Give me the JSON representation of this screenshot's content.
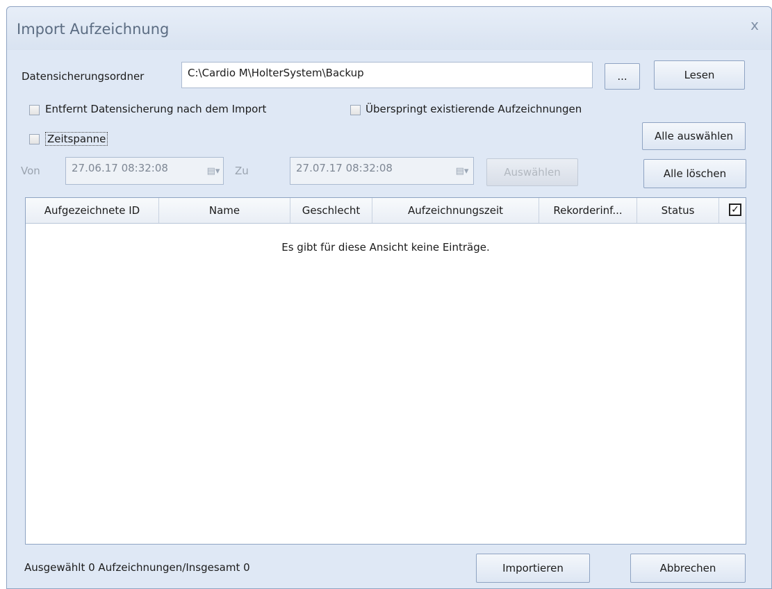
{
  "window": {
    "title": "Import Aufzeichnung",
    "close_glyph": "x"
  },
  "backup": {
    "label": "Datensicherungsordner",
    "path": "C:\\Cardio M\\HolterSystem\\Backup",
    "browse_label": "...",
    "read_label": "Lesen"
  },
  "options": {
    "remove_backup_label": "Entfernt Datensicherung nach dem Import",
    "skip_existing_label": "Überspringt existierende Aufzeichnungen",
    "timespan_label": "Zeitspanne"
  },
  "range": {
    "from_label": "Von",
    "from_value": "27.06.17  08:32:08",
    "to_label": "Zu",
    "to_value": "27.07.17  08:32:08",
    "select_label": "Auswählen"
  },
  "actions": {
    "select_all_label": "Alle auswählen",
    "clear_all_label": "Alle löschen",
    "import_label": "Importieren",
    "cancel_label": "Abbrechen"
  },
  "table": {
    "columns": [
      "Aufgezeichnete ID",
      "Name",
      "Geschlecht",
      "Aufzeichnungszeit",
      "Rekorderinf...",
      "Status"
    ],
    "header_check_glyph": "✓",
    "empty_message": "Es gibt für diese Ansicht keine Einträge."
  },
  "status": {
    "summary": "Ausgewählt 0 Aufzeichnungen/Insgesamt 0"
  }
}
